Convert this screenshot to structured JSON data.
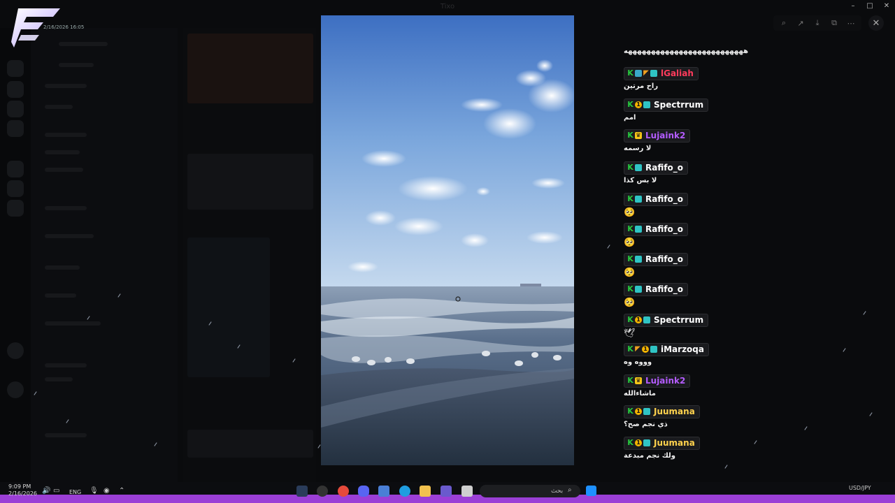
{
  "window": {
    "title": "Tixo",
    "overlay_timestamp": "2/16/2026 16:05"
  },
  "viewer_toolbar": {
    "icons": [
      "zoom-icon",
      "share-icon",
      "download-icon",
      "open-external-icon",
      "more-icon"
    ],
    "close_icon": "close-icon"
  },
  "chat": {
    "top_message": "ههههههههههههههههههههههههههه",
    "messages": [
      {
        "username": "lGaliah",
        "color": "#ff3b5c",
        "badges": [
          "k",
          "gift",
          "flag",
          "chip"
        ],
        "text": "راح مرتين"
      },
      {
        "username": "Spectrrum",
        "color": "#ffffff",
        "badges": [
          "k",
          "coin",
          "chip"
        ],
        "text": "امم"
      },
      {
        "username": "Lujaink2",
        "color": "#b45cff",
        "badges": [
          "k",
          "crown"
        ],
        "text": "لا رسمه"
      },
      {
        "username": "Rafifo_o",
        "color": "#ffffff",
        "badges": [
          "k",
          "chip"
        ],
        "text": "لا بس كذا"
      },
      {
        "username": "Rafifo_o",
        "color": "#ffffff",
        "badges": [
          "k",
          "chip"
        ],
        "text": "",
        "emoji": "🥺"
      },
      {
        "username": "Rafifo_o",
        "color": "#ffffff",
        "badges": [
          "k",
          "chip"
        ],
        "text": "",
        "emoji": "🥺"
      },
      {
        "username": "Rafifo_o",
        "color": "#ffffff",
        "badges": [
          "k",
          "chip"
        ],
        "text": "",
        "emoji": "🥺"
      },
      {
        "username": "Rafifo_o",
        "color": "#ffffff",
        "badges": [
          "k",
          "chip"
        ],
        "text": "",
        "emoji": "🥺"
      },
      {
        "username": "Spectrrum",
        "color": "#ffffff",
        "badges": [
          "k",
          "coin",
          "chip"
        ],
        "text": "",
        "emoji": "🕊"
      },
      {
        "username": "iMarzoqa",
        "color": "#ffffff",
        "badges": [
          "k",
          "flag",
          "coin",
          "chip"
        ],
        "text": "وووه وه"
      },
      {
        "username": "Lujaink2",
        "color": "#b45cff",
        "badges": [
          "k",
          "crown"
        ],
        "text": "ماشاءالله"
      },
      {
        "username": "Juumana",
        "color": "#ffd24d",
        "badges": [
          "k",
          "coin",
          "chip"
        ],
        "text": "ذي نجم صح؟"
      },
      {
        "username": "Juumana",
        "color": "#ffd24d",
        "badges": [
          "k",
          "coin",
          "chip"
        ],
        "text": "ولك نجم مبدعة"
      }
    ]
  },
  "taskbar": {
    "time": "9:09 PM",
    "date": "2/16/2026",
    "language": "ENG",
    "search_placeholder": "بحث",
    "currency": "USD/JPY"
  }
}
